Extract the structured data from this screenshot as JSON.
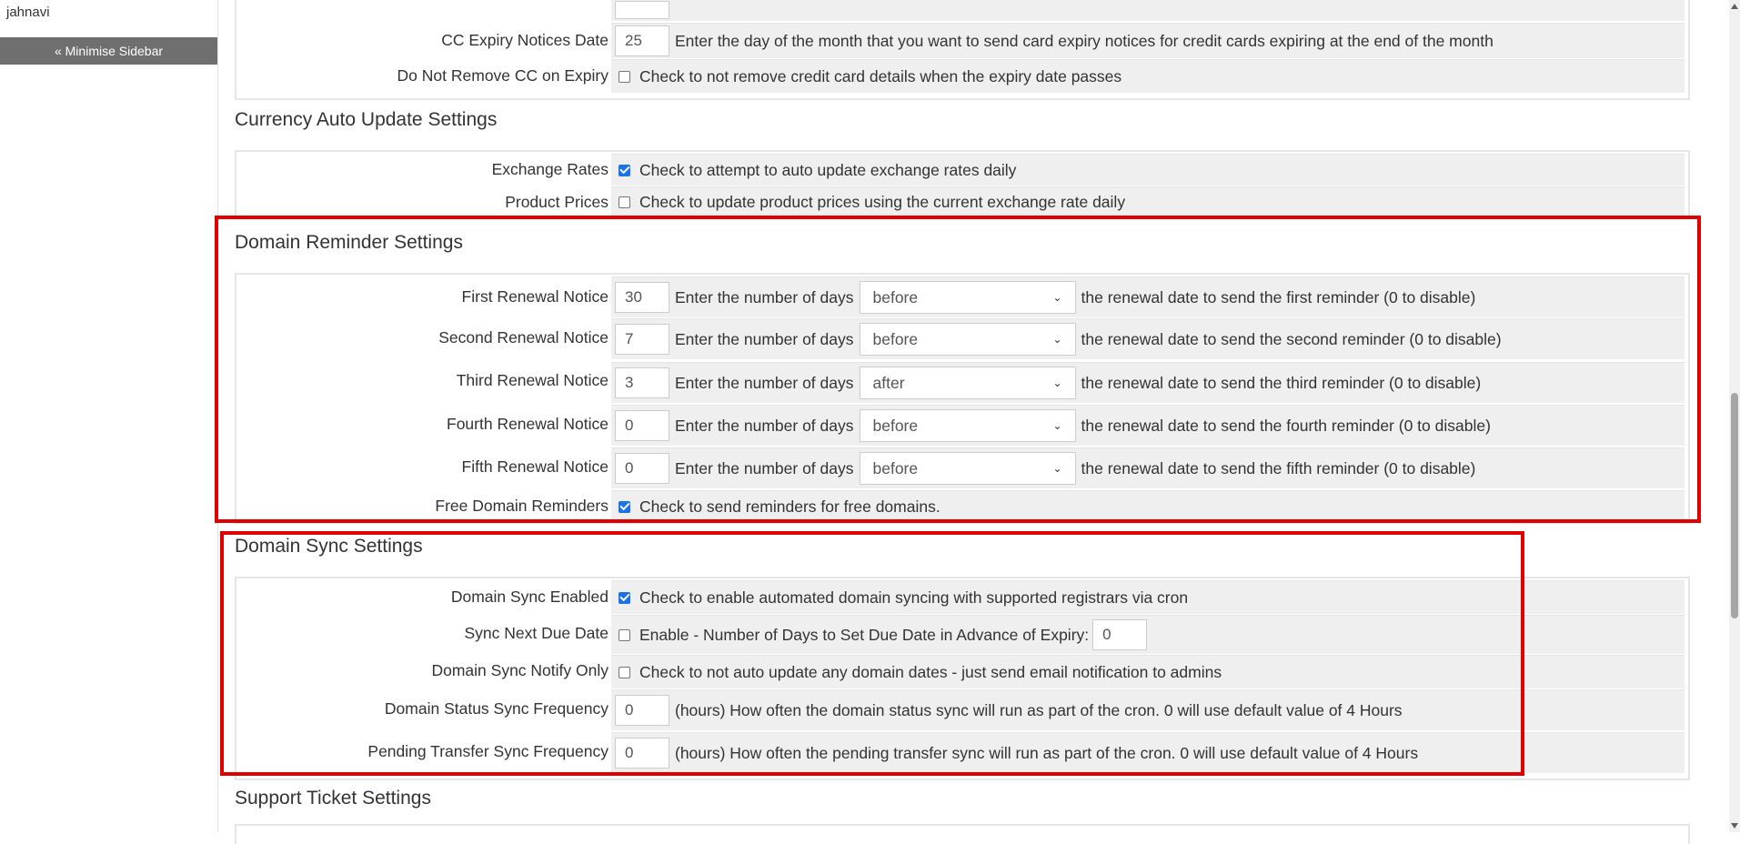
{
  "sidebar": {
    "username": "jahnavi",
    "minimise_label": "« Minimise Sidebar"
  },
  "top_partial": {
    "rows": [
      {
        "label": "CC Expiry Notices Date",
        "value": "25",
        "text": "Enter the day of the month that you want to send card expiry notices for credit cards expiring at the end of the month"
      },
      {
        "label": "Do Not Remove CC on Expiry",
        "checked": false,
        "text": "Check to not remove credit card details when the expiry date passes"
      }
    ]
  },
  "currency": {
    "title": "Currency Auto Update Settings",
    "rows": [
      {
        "label": "Exchange Rates",
        "checked": true,
        "text": "Check to attempt to auto update exchange rates daily"
      },
      {
        "label": "Product Prices",
        "checked": false,
        "text": "Check to update product prices using the current exchange rate daily"
      }
    ]
  },
  "domain_reminder": {
    "title": "Domain Reminder Settings",
    "days_text": "Enter the number of days",
    "rows": [
      {
        "label": "First Renewal Notice",
        "days": "30",
        "when": "before",
        "tail": "the renewal date to send the first reminder (0 to disable)"
      },
      {
        "label": "Second Renewal Notice",
        "days": "7",
        "when": "before",
        "tail": "the renewal date to send the second reminder (0 to disable)"
      },
      {
        "label": "Third Renewal Notice",
        "days": "3",
        "when": "after",
        "tail": "the renewal date to send the third reminder (0 to disable)"
      },
      {
        "label": "Fourth Renewal Notice",
        "days": "0",
        "when": "before",
        "tail": "the renewal date to send the fourth reminder (0 to disable)"
      },
      {
        "label": "Fifth Renewal Notice",
        "days": "0",
        "when": "before",
        "tail": "the renewal date to send the fifth reminder (0 to disable)"
      }
    ],
    "free": {
      "label": "Free Domain Reminders",
      "checked": true,
      "text": "Check to send reminders for free domains."
    }
  },
  "domain_sync": {
    "title": "Domain Sync Settings",
    "enabled": {
      "label": "Domain Sync Enabled",
      "checked": true,
      "text": "Check to enable automated domain syncing with supported registrars via cron"
    },
    "next_due": {
      "label": "Sync Next Due Date",
      "checked": false,
      "text": "Enable - Number of Days to Set Due Date in Advance of Expiry:",
      "value": "0"
    },
    "notify_only": {
      "label": "Domain Sync Notify Only",
      "checked": false,
      "text": "Check to not auto update any domain dates - just send email notification to admins"
    },
    "status_freq": {
      "label": "Domain Status Sync Frequency",
      "value": "0",
      "text": "(hours) How often the domain status sync will run as part of the cron. 0 will use default value of 4 Hours"
    },
    "transfer_freq": {
      "label": "Pending Transfer Sync Frequency",
      "value": "0",
      "text": "(hours) How often the pending transfer sync will run as part of the cron. 0 will use default value of 4 Hours"
    }
  },
  "support": {
    "title": "Support Ticket Settings"
  },
  "colors": {
    "highlight": "#e00000",
    "checkbox_on": "#1a73e8",
    "row_bg": "#efefef"
  }
}
